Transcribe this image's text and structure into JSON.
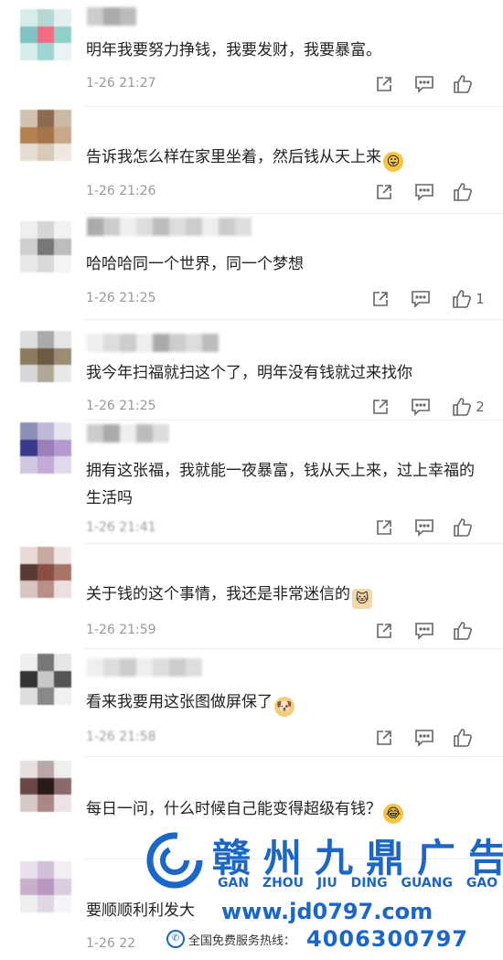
{
  "comments": [
    {
      "text": "明年我要努力挣钱，我要发财，我要暴富。",
      "time": "1-26 21:27",
      "likes": "",
      "emoji": ""
    },
    {
      "text": "告诉我怎么样在家里坐着，然后钱从天上来",
      "time": "1-26 21:26",
      "likes": "",
      "emoji": "😛"
    },
    {
      "text": "哈哈哈同一个世界，同一个梦想",
      "time": "1-26 21:25",
      "likes": "1",
      "emoji": ""
    },
    {
      "text": "我今年扫福就扫这个了，明年没有钱就过来找你",
      "time": "1-26 21:25",
      "likes": "2",
      "emoji": ""
    },
    {
      "text": "拥有这张福，我就能一夜暴富，钱从天上来，过上幸福的生活吗",
      "time": "1-26 21:41",
      "likes": "",
      "emoji": ""
    },
    {
      "text": "关于钱的这个事情，我还是非常迷信的",
      "time": "1-26 21:59",
      "likes": "",
      "emoji": "🐱"
    },
    {
      "text": "看来我要用这张图做屏保了",
      "time": "1-26 21:58",
      "likes": "",
      "emoji": "🐶"
    },
    {
      "text": "每日一问，什么时候自己能变得超级有钱？",
      "time": "",
      "likes": "",
      "emoji": "😂"
    },
    {
      "text": "要顺顺利利发大",
      "time": "1-26 22",
      "likes": "",
      "emoji": ""
    }
  ],
  "icons": {
    "share": "share-icon",
    "reply": "comment-icon",
    "like": "thumbs-up-icon"
  },
  "watermark": {
    "name_cn": "赣州九鼎广告",
    "name_pinyin": "GAN ZHOU JIU DING GUANG GAO",
    "url": "www.jd0797.com",
    "hotline_label": "全国免费服务热线：",
    "phone": "4006300797"
  },
  "colors": {
    "accent": "#1b66c9",
    "muted": "#999999"
  }
}
